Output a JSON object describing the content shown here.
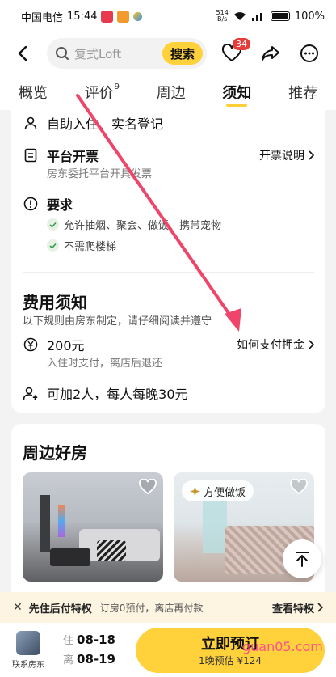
{
  "status_bar": {
    "carrier": "中国电信",
    "time": "15:44",
    "net_speed_value": "514",
    "net_speed_unit": "B/s",
    "battery": "100%"
  },
  "header": {
    "search_placeholder": "复式Loft",
    "search_button": "搜索",
    "favorites_badge": "34"
  },
  "tabs": [
    {
      "label": "概览",
      "sup": ""
    },
    {
      "label": "评价",
      "sup": "9"
    },
    {
      "label": "周边",
      "sup": ""
    },
    {
      "label": "须知",
      "sup": "",
      "active": true
    },
    {
      "label": "推荐",
      "sup": ""
    }
  ],
  "rules": {
    "checkin": "自助入住、实名登记",
    "invoice_title": "平台开票",
    "invoice_desc": "房东委托平台开具发票",
    "invoice_link": "开票说明",
    "requirements_title": "要求",
    "requirements": [
      "允许抽烟、聚会、做饭、携带宠物",
      "不需爬楼梯"
    ]
  },
  "fees": {
    "title": "费用须知",
    "subtitle": "以下规则由房东制定，请仔细阅读并遵守",
    "deposit": "200元",
    "deposit_desc": "入住时支付，离店后退还",
    "deposit_link": "如何支付押金",
    "extra_guests": "可加2人，每人每晚30元"
  },
  "nearby": {
    "title": "周边好房",
    "tag": "方便做饭"
  },
  "privilege": {
    "title": "先住后付特权",
    "desc": "订房0预付，离店再付款",
    "link": "查看特权"
  },
  "bottom": {
    "host_label": "联系房东",
    "checkin_key": "住",
    "checkin_date": "08-18",
    "checkout_key": "离",
    "checkout_date": "08-19",
    "book_label": "立即预订",
    "book_sub": "1晚预估 ¥124"
  },
  "watermark": "guan05.com",
  "colors": {
    "accent": "#ffd13b",
    "badge": "#e93a3a",
    "annotation_arrow": "#f0456a"
  }
}
